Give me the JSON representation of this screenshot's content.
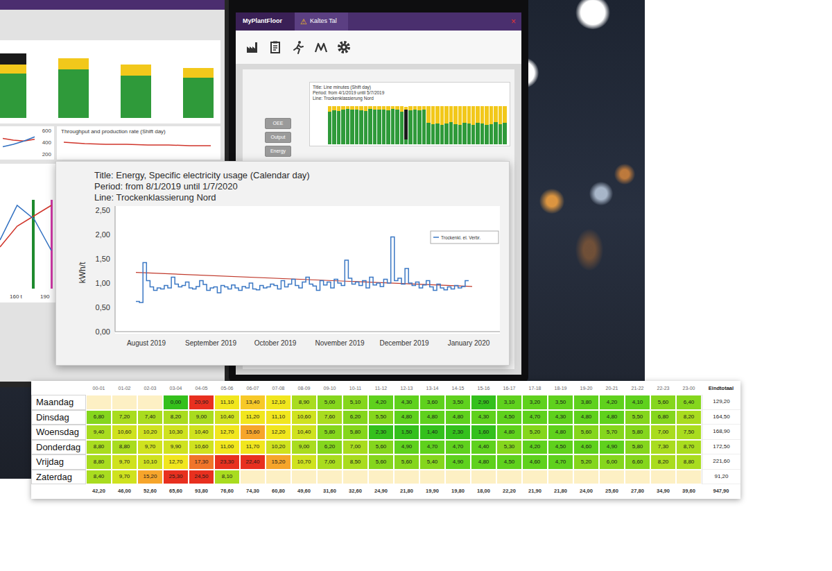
{
  "left_monitor": {
    "top_bars": [
      {
        "black": 10,
        "yellow": 8,
        "green": 40
      },
      {
        "black": 0,
        "yellow": 10,
        "green": 44
      },
      {
        "black": 0,
        "yellow": 10,
        "green": 38
      },
      {
        "black": 0,
        "yellow": 9,
        "green": 36
      }
    ],
    "mini_chart": {
      "ticks": [
        "600",
        "400",
        "200"
      ],
      "red": [
        2.2,
        2.0,
        1.9,
        2.1
      ],
      "blue": [
        1.2,
        1.5,
        1.9,
        2.4
      ]
    },
    "throughput": {
      "title": "Throughput and production rate (Shift day)",
      "red": [
        1.9,
        1.7,
        1.6,
        1.6,
        1.5,
        1.5,
        1.4,
        1.4
      ]
    },
    "line_chart": {
      "blue": [
        1.4,
        2.4,
        2.0,
        1.1
      ],
      "red": [
        1.2,
        1.8,
        2.1,
        2.4
      ],
      "markers": [
        {
          "color": "#1e8a2e"
        },
        {
          "color": "#d13aa8"
        }
      ],
      "x_labels": [
        "160 t",
        "190"
      ]
    }
  },
  "right_monitor": {
    "app_title": "MyPlantFloor",
    "tab": {
      "icon": "⚠",
      "label": "Kaltes Tal"
    },
    "close": "×",
    "side_buttons": [
      "OEE",
      "Output",
      "Energy"
    ],
    "main_chart": {
      "title_lines": [
        "Title: Line minutes (Shift day)",
        "Period: from 4/1/2019 until 5/7/2019",
        "Line: Trockenklassierung Nord"
      ],
      "green": [
        78,
        82,
        80,
        84,
        85,
        83,
        84,
        82,
        80,
        85,
        84,
        83,
        84,
        81,
        85,
        83,
        79,
        12,
        82,
        84,
        81,
        83,
        52,
        48,
        50,
        46,
        50,
        54,
        49,
        46,
        51,
        50,
        47,
        52,
        50,
        47,
        49,
        53,
        48,
        51
      ],
      "yellow": [
        14,
        10,
        12,
        8,
        7,
        9,
        8,
        10,
        12,
        7,
        8,
        9,
        8,
        11,
        7,
        9,
        13,
        6,
        10,
        8,
        11,
        9,
        40,
        44,
        42,
        46,
        42,
        38,
        43,
        46,
        41,
        42,
        45,
        40,
        42,
        45,
        43,
        39,
        44,
        41
      ],
      "black": [
        0,
        0,
        0,
        0,
        0,
        0,
        0,
        0,
        0,
        0,
        0,
        0,
        0,
        0,
        0,
        0,
        0,
        72,
        0,
        0,
        0,
        0,
        0,
        0,
        0,
        0,
        0,
        0,
        0,
        0,
        0,
        0,
        0,
        0,
        0,
        0,
        0,
        0,
        0,
        0
      ]
    }
  },
  "energy_chart": {
    "title": "Title: Energy, Specific electricity usage (Calendar day)",
    "period": "Period: from 8/1/2019 until 1/7/2020",
    "line": "Line: Trockenklassierung Nord",
    "y_label": "kWh/t",
    "y_ticks": [
      "2,50",
      "2,00",
      "1,50",
      "1,00",
      "0,50",
      "0,00"
    ],
    "x_labels": [
      "August 2019",
      "September 2019",
      "October 2019",
      "November 2019",
      "December 2019",
      "January 2020"
    ],
    "legend": "Trockenkl. el. Verbr.",
    "usage": [
      0.62,
      0.6,
      1.42,
      1.05,
      0.92,
      0.85,
      0.9,
      0.88,
      0.95,
      0.9,
      1.12,
      0.98,
      0.92,
      0.95,
      1.02,
      0.9,
      0.88,
      0.93,
      1.05,
      0.97,
      0.85,
      0.9,
      0.92,
      0.8,
      0.95,
      0.92,
      0.88,
      0.96,
      0.9,
      0.85,
      0.93,
      0.9,
      1.0,
      0.88,
      0.86,
      0.95,
      0.9,
      0.92,
      0.98,
      0.95,
      0.88,
      1.05,
      0.92,
      0.98,
      1.08,
      0.95,
      0.9,
      1.02,
      1.12,
      0.98,
      0.94,
      0.85,
      1.05,
      0.96,
      1.02,
      0.9,
      1.08,
      1.0,
      0.95,
      1.47,
      1.1,
      0.98,
      1.02,
      0.95,
      1.05,
      0.9,
      1.12,
      0.96,
      1.0,
      0.93,
      1.08,
      1.0,
      1.95,
      1.05,
      1.1,
      0.98,
      1.3,
      1.0,
      0.95,
      1.02,
      0.9,
      0.96,
      1.05,
      0.92,
      0.85,
      0.98,
      0.9,
      0.86,
      0.92,
      0.88,
      0.95,
      0.9,
      0.93,
      1.05
    ],
    "trend": [
      1.22,
      0.93
    ]
  },
  "heatmap": {
    "columns": [
      "00-01",
      "01-02",
      "02-03",
      "03-04",
      "04-05",
      "05-06",
      "06-07",
      "07-08",
      "08-09",
      "09-10",
      "10-11",
      "11-12",
      "12-13",
      "13-14",
      "14-15",
      "15-16",
      "16-17",
      "17-18",
      "18-19",
      "19-20",
      "20-21",
      "21-22",
      "22-23",
      "23-00"
    ],
    "total_label": "Eindtotaal",
    "rows": [
      {
        "day": "Maandag",
        "cells": [
          "",
          "",
          "",
          "0,00",
          "20,90",
          "11,10",
          "13,40",
          "12,10",
          "8,90",
          "5,00",
          "5,10",
          "4,20",
          "4,30",
          "3,60",
          "3,50",
          "2,90",
          "3,10",
          "3,20",
          "3,50",
          "3,80",
          "4,20",
          "4,10",
          "5,60",
          "6,40"
        ],
        "total": "129,20"
      },
      {
        "day": "Dinsdag",
        "cells": [
          "6,80",
          "7,20",
          "7,40",
          "8,20",
          "9,00",
          "10,40",
          "11,20",
          "11,10",
          "10,60",
          "7,60",
          "6,20",
          "5,50",
          "4,80",
          "4,80",
          "4,80",
          "4,30",
          "4,50",
          "4,70",
          "4,30",
          "4,80",
          "4,80",
          "5,50",
          "6,80",
          "8,20"
        ],
        "total": "164,50"
      },
      {
        "day": "Woensdag",
        "cells": [
          "9,40",
          "10,60",
          "10,20",
          "10,30",
          "10,40",
          "12,70",
          "15,60",
          "12,20",
          "10,40",
          "5,80",
          "5,80",
          "2,30",
          "1,50",
          "1,40",
          "2,30",
          "1,60",
          "4,80",
          "5,20",
          "4,80",
          "5,60",
          "5,70",
          "5,80",
          "7,00",
          "7,50"
        ],
        "total": "168,90"
      },
      {
        "day": "Donderdag",
        "cells": [
          "8,80",
          "8,80",
          "9,70",
          "9,90",
          "10,60",
          "11,00",
          "11,70",
          "10,20",
          "9,00",
          "6,20",
          "7,00",
          "5,60",
          "4,90",
          "4,70",
          "4,70",
          "4,40",
          "5,30",
          "4,20",
          "4,50",
          "4,60",
          "4,90",
          "5,80",
          "7,30",
          "8,70"
        ],
        "total": "172,50"
      },
      {
        "day": "Vrijdag",
        "cells": [
          "8,80",
          "9,70",
          "10,10",
          "12,70",
          "17,30",
          "23,30",
          "22,40",
          "15,20",
          "10,70",
          "7,00",
          "8,50",
          "5,60",
          "5,60",
          "5,40",
          "4,90",
          "4,80",
          "4,50",
          "4,60",
          "4,70",
          "5,20",
          "6,00",
          "6,60",
          "8,20",
          "8,80"
        ],
        "total": "221,60"
      },
      {
        "day": "Zaterdag",
        "cells": [
          "8,40",
          "9,70",
          "15,20",
          "25,30",
          "24,50",
          "8,10",
          "",
          "",
          "",
          "",
          "",
          "",
          "",
          "",
          "",
          "",
          "",
          "",
          "",
          "",
          "",
          "",
          "",
          ""
        ],
        "total": "91,20"
      }
    ],
    "totals": [
      "42,20",
      "46,00",
      "52,60",
      "65,60",
      "93,80",
      "76,60",
      "74,30",
      "60,80",
      "49,60",
      "31,60",
      "32,60",
      "24,90",
      "21,80",
      "19,90",
      "19,80",
      "18,00",
      "22,20",
      "21,90",
      "21,80",
      "24,00",
      "25,60",
      "27,80",
      "34,90",
      "39,60"
    ],
    "grand_total": "947,90"
  }
}
